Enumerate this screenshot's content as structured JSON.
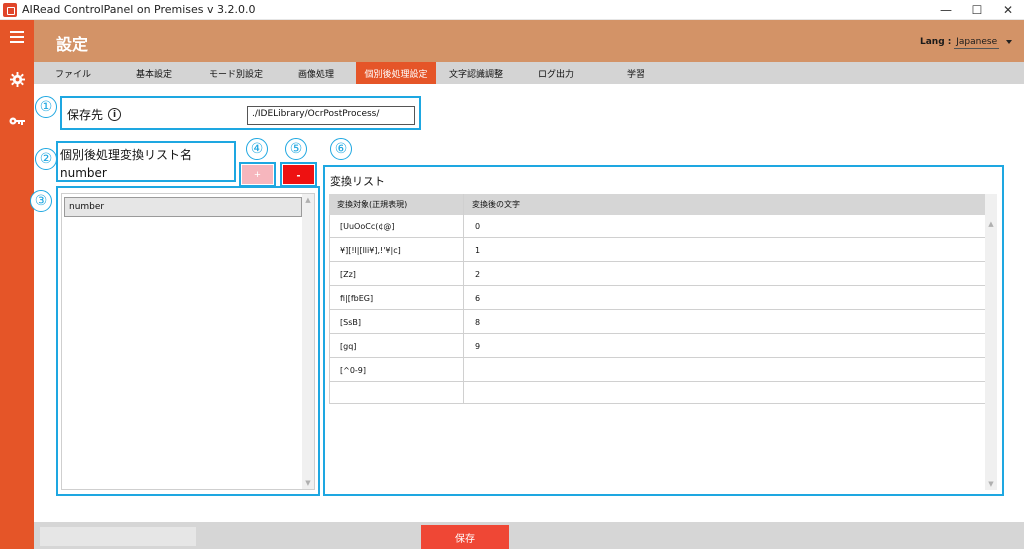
{
  "window": {
    "title": "AIRead ControlPanel on Premises v 3.2.0.0",
    "minimize": "—",
    "maximize": "☐",
    "close": "✕"
  },
  "sidebar": {
    "icons": [
      "menu-icon",
      "gear-icon",
      "key-icon"
    ]
  },
  "header": {
    "title": "設定",
    "lang_label": "Lang :",
    "lang_value": "Japanese"
  },
  "tabs": [
    {
      "label": "ファイル"
    },
    {
      "label": "基本設定"
    },
    {
      "label": "モード別設定"
    },
    {
      "label": "画像処理"
    },
    {
      "label": "個別後処理設定"
    },
    {
      "label": "文字認識調整"
    },
    {
      "label": "ログ出力"
    },
    {
      "label": "学習"
    }
  ],
  "active_tab": "個別後処理設定",
  "callout_numbers": [
    "①",
    "②",
    "③",
    "④",
    "⑤",
    "⑥"
  ],
  "save_location": {
    "label": "保存先",
    "value": "./IDELibrary/OcrPostProcess/"
  },
  "list_name": {
    "label": "個別後処理変換リスト名",
    "value": "number"
  },
  "buttons": {
    "add": "+",
    "remove": "-",
    "save": "保存"
  },
  "list_items": [
    "number"
  ],
  "conversion": {
    "title": "変換リスト",
    "headers": [
      "変換対象(正規表現)",
      "変換後の文字"
    ],
    "rows": [
      [
        "[UuOoCc(¢@]",
        "0"
      ],
      [
        "¥][!l|[lli¥],!'¥|c]",
        "1"
      ],
      [
        "[Zz]",
        "2"
      ],
      [
        "fi|[fbEG]",
        "6"
      ],
      [
        "[SsB]",
        "8"
      ],
      [
        "[gq]",
        "9"
      ],
      [
        "[^0-9]",
        ""
      ],
      [
        "",
        ""
      ]
    ]
  },
  "colors": {
    "sidebar": "#e55528",
    "header": "#d39367",
    "active_tab": "#e55528",
    "callout": "#1ea7e1",
    "save_button": "#ef4735",
    "remove_button": "#ee1111",
    "add_button": "#f6b6bd"
  }
}
